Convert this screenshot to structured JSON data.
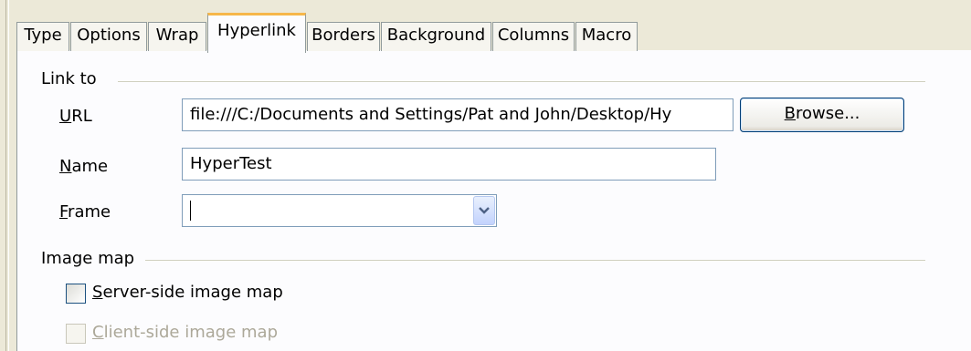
{
  "tabs": [
    {
      "label": "Type",
      "active": false
    },
    {
      "label": "Options",
      "active": false
    },
    {
      "label": "Wrap",
      "active": false
    },
    {
      "label": "Hyperlink",
      "active": true
    },
    {
      "label": "Borders",
      "active": false
    },
    {
      "label": "Background",
      "active": false
    },
    {
      "label": "Columns",
      "active": false
    },
    {
      "label": "Macro",
      "active": false
    }
  ],
  "link_to": {
    "section_label": "Link to",
    "url_label_access": "U",
    "url_label_rest": "RL",
    "url_value": "file:///C:/Documents and Settings/Pat and John/Desktop/Hy",
    "browse_access": "B",
    "browse_rest": "rowse...",
    "name_label_access": "N",
    "name_label_rest": "ame",
    "name_value": "HyperTest",
    "frame_label_access": "F",
    "frame_label_rest": "rame",
    "frame_value": ""
  },
  "image_map": {
    "section_label": "Image map",
    "server_side_access": "S",
    "server_side_rest": "erver-side image map",
    "server_side_checked": false,
    "client_side_access": "C",
    "client_side_rest": "lient-side image map",
    "client_side_checked": false,
    "client_side_enabled": false
  },
  "icons": {
    "dropdown": "chevron-down-icon"
  }
}
